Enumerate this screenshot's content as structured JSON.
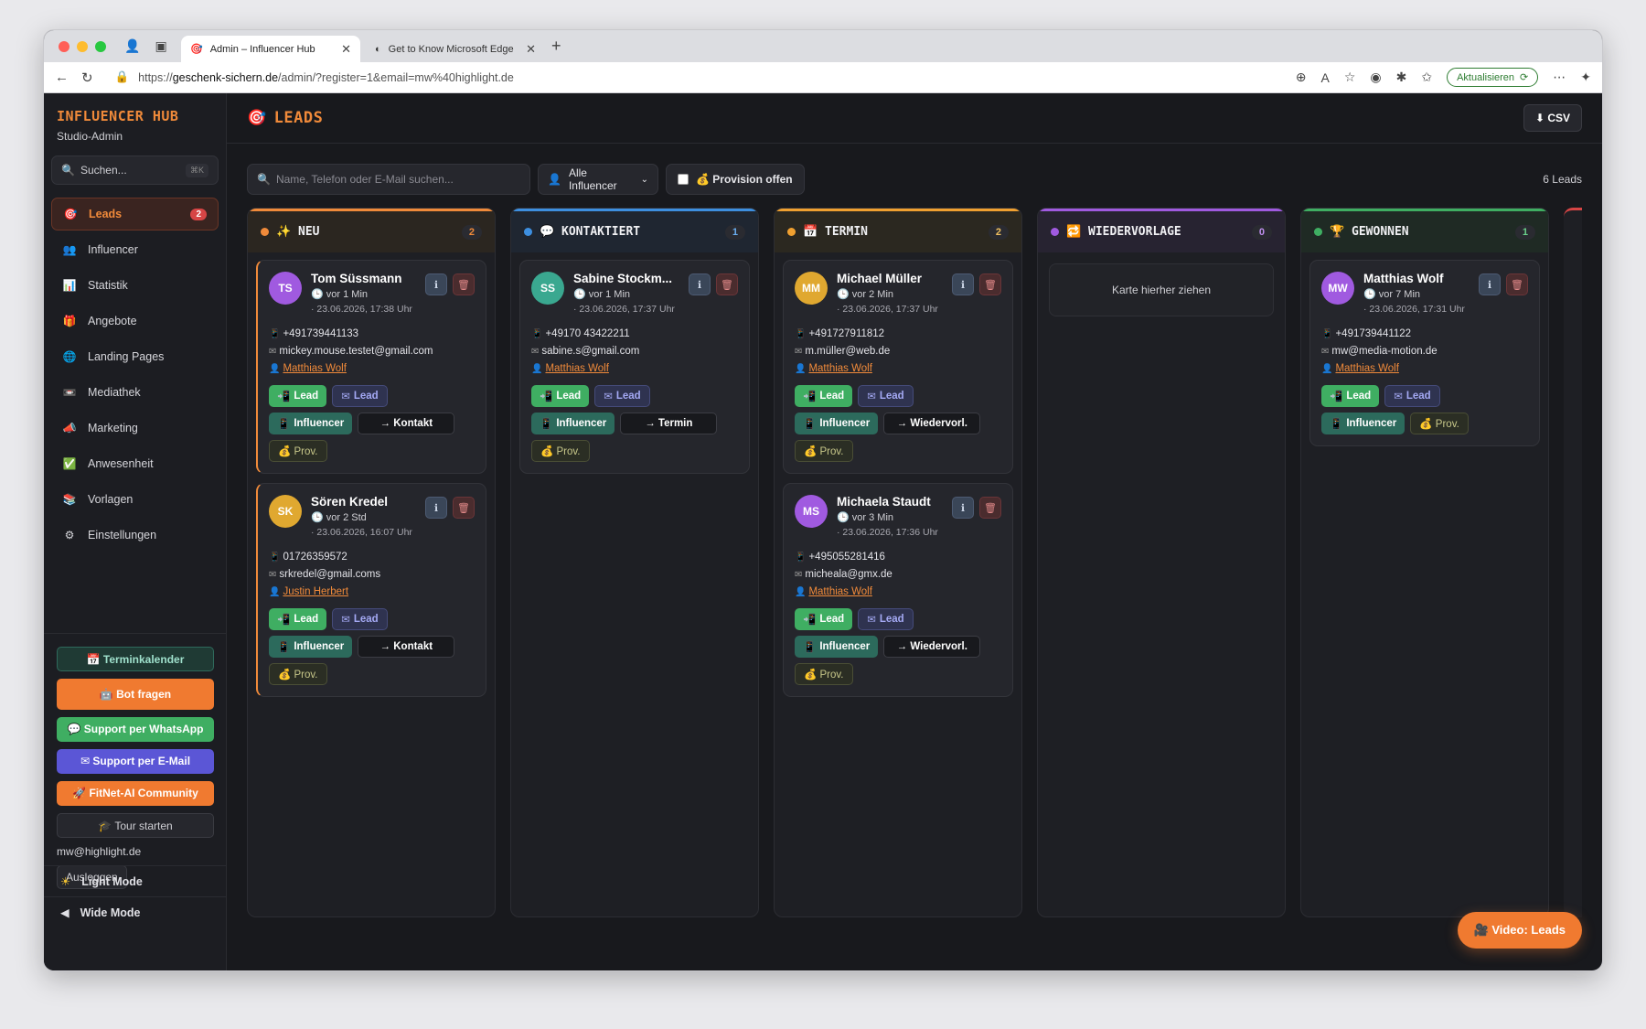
{
  "browser": {
    "tabs": [
      {
        "label": "Admin – Influencer Hub"
      },
      {
        "label": "Get to Know Microsoft Edge"
      }
    ],
    "url_prefix": "https://",
    "url_host": "geschenk-sichern.de",
    "url_path": "/admin/?register=1&email=mw%40highlight.de",
    "update_label": "Aktualisieren"
  },
  "sidebar": {
    "brand_title": "INFLUENCER HUB",
    "brand_sub": "Studio-Admin",
    "search_placeholder": "Suchen...",
    "search_kbd": "⌘K",
    "items": [
      {
        "label": "Leads",
        "icon": "🎯",
        "badge": "2"
      },
      {
        "label": "Influencer",
        "icon": "👥"
      },
      {
        "label": "Statistik",
        "icon": "📊"
      },
      {
        "label": "Angebote",
        "icon": "🎁"
      },
      {
        "label": "Landing Pages",
        "icon": "🌐"
      },
      {
        "label": "Mediathek",
        "icon": "📼"
      },
      {
        "label": "Marketing",
        "icon": "📣"
      },
      {
        "label": "Anwesenheit",
        "icon": "✅"
      },
      {
        "label": "Vorlagen",
        "icon": "📚"
      },
      {
        "label": "Einstellungen",
        "icon": "⚙"
      }
    ],
    "buttons": {
      "calendar": "📅 Terminkalender",
      "bot": "🤖 Bot fragen",
      "whatsapp": "💬 Support per WhatsApp",
      "email": "✉ Support per E-Mail",
      "community": "🚀 FitNet-AI Community",
      "tour": "🎓 Tour starten"
    },
    "user_email": "mw@highlight.de",
    "logout": "Ausloggen",
    "light_mode": "Light Mode",
    "wide_mode": "Wide Mode"
  },
  "main": {
    "title": "LEADS",
    "csv": "⬇ CSV",
    "search_placeholder": "Name, Telefon oder E-Mail suchen...",
    "influencer_filter": "Alle Influencer",
    "provision_filter": "💰 Provision offen",
    "lead_count": "6 Leads",
    "video_button": "🎥 Video: Leads",
    "drop_hint": "Karte hierher ziehen"
  },
  "columns": [
    {
      "title": "✨ NEU",
      "count": "2",
      "color": "#f08a3a"
    },
    {
      "title": "💬 KONTAKTIERT",
      "count": "1",
      "color": "#3d8fe0"
    },
    {
      "title": "📅 TERMIN",
      "count": "2",
      "color": "#f0a030"
    },
    {
      "title": "🔁 WIEDERVORLAGE",
      "count": "0",
      "color": "#a05ae0"
    },
    {
      "title": "🏆 GEWONNEN",
      "count": "1",
      "color": "#3fae62"
    }
  ],
  "cards": [
    {
      "initials": "TS",
      "avatar_color": "#a05ae0",
      "name": "Tom Süssmann",
      "ago": "vor 1 Min",
      "date": "· 23.06.2026, 17:38 Uhr",
      "phone": "+491739441133",
      "email": "mickey.mouse.testet@gmail.com",
      "owner": "Matthias Wolf",
      "tag_lead": "Lead",
      "tag_mail": "Lead",
      "tag_influencer": "Influencer",
      "action": "→ Kontakt",
      "prov": "💰 Prov."
    },
    {
      "initials": "SK",
      "avatar_color": "#e0a830",
      "name": "Sören Kredel",
      "ago": "vor 2 Std",
      "date": "· 23.06.2026, 16:07 Uhr",
      "phone": "01726359572",
      "email": "srkredel@gmail.coms",
      "owner": "Justin Herbert",
      "tag_lead": "Lead",
      "tag_mail": "Lead",
      "tag_influencer": "Influencer",
      "action": "→ Kontakt",
      "prov": "💰 Prov."
    },
    {
      "initials": "SS",
      "avatar_color": "#3aa890",
      "name": "Sabine Stockm...",
      "ago": "vor 1 Min",
      "date": "· 23.06.2026, 17:37 Uhr",
      "phone": "+49170 43422211",
      "email": "sabine.s@gmail.com",
      "owner": "Matthias Wolf",
      "tag_lead": "Lead",
      "tag_mail": "Lead",
      "tag_influencer": "Influencer",
      "action": "→ Termin",
      "prov": "💰 Prov."
    },
    {
      "initials": "MM",
      "avatar_color": "#e0a830",
      "name": "Michael Müller",
      "ago": "vor 2 Min",
      "date": "· 23.06.2026, 17:37 Uhr",
      "phone": "+491727911812",
      "email": "m.müller@web.de",
      "owner": "Matthias Wolf",
      "tag_lead": "Lead",
      "tag_mail": "Lead",
      "tag_influencer": "Influencer",
      "action": "→ Wiedervorl.",
      "prov": "💰 Prov."
    },
    {
      "initials": "MS",
      "avatar_color": "#a05ae0",
      "name": "Michaela Staudt",
      "ago": "vor 3 Min",
      "date": "· 23.06.2026, 17:36 Uhr",
      "phone": "+495055281416",
      "email": "micheala@gmx.de",
      "owner": "Matthias Wolf",
      "tag_lead": "Lead",
      "tag_mail": "Lead",
      "tag_influencer": "Influencer",
      "action": "→ Wiedervorl.",
      "prov": "💰 Prov."
    },
    {
      "initials": "MW",
      "avatar_color": "#a05ae0",
      "name": "Matthias Wolf",
      "ago": "vor 7 Min",
      "date": "· 23.06.2026, 17:31 Uhr",
      "phone": "+491739441122",
      "email": "mw@media-motion.de",
      "owner": "Matthias Wolf",
      "tag_lead": "Lead",
      "tag_mail": "Lead",
      "tag_influencer": "Influencer",
      "prov": "💰 Prov."
    }
  ]
}
